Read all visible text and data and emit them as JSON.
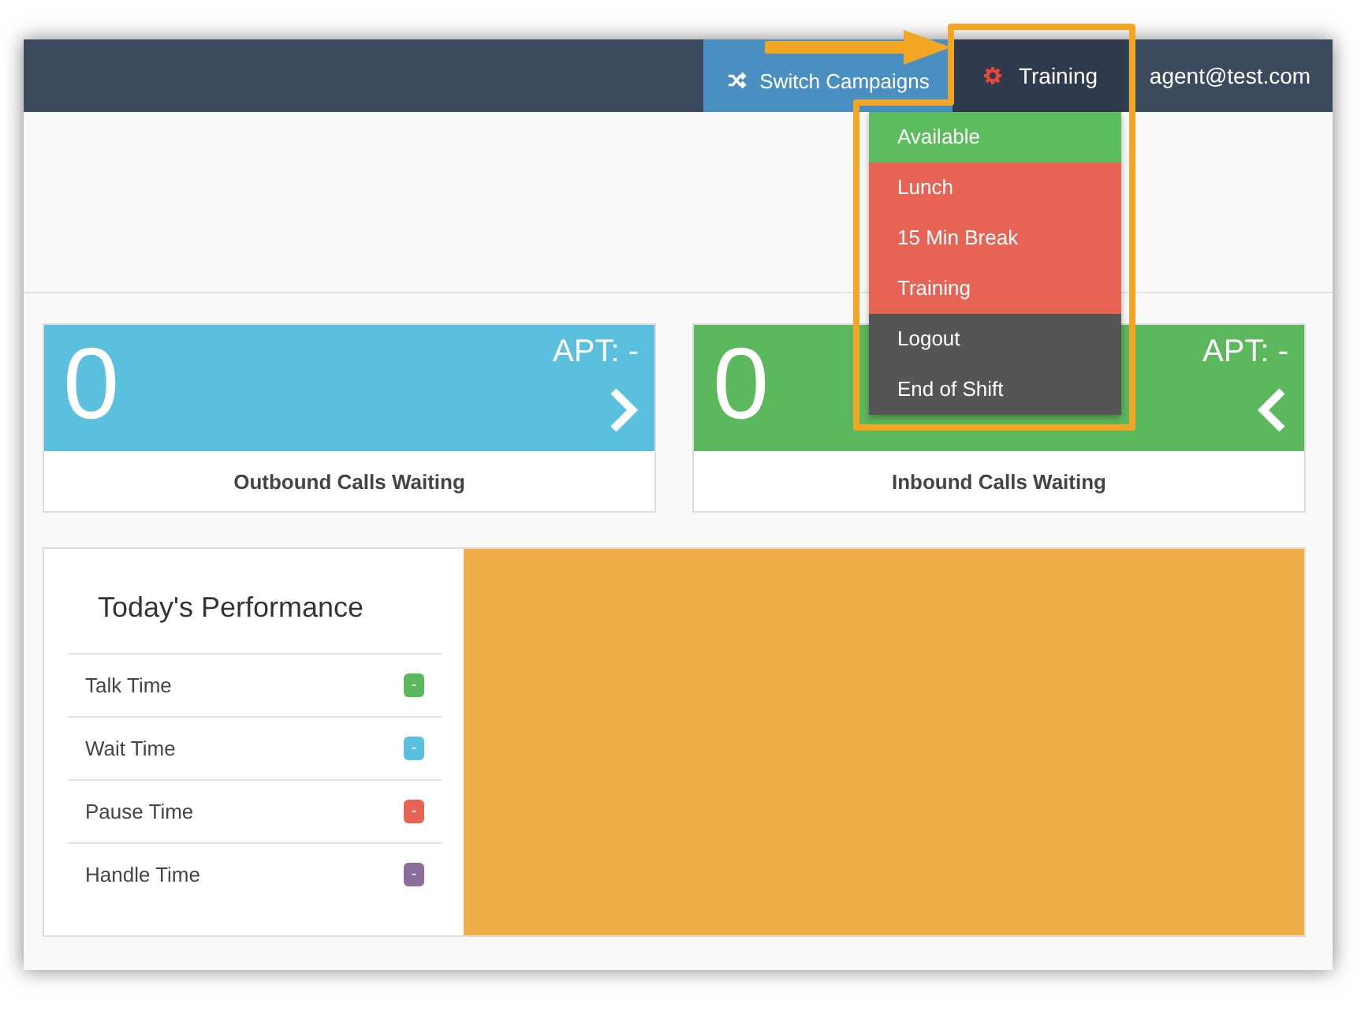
{
  "navbar": {
    "switch_button": "Switch Campaigns",
    "status_button": "Training",
    "user": "agent@test.com"
  },
  "status_menu": [
    {
      "label": "Available",
      "color": "#5cbd5e"
    },
    {
      "label": "Lunch",
      "color": "#e76455"
    },
    {
      "label": "15 Min Break",
      "color": "#e76455"
    },
    {
      "label": "Training",
      "color": "#e76455"
    },
    {
      "label": "Logout",
      "color": "#555555"
    },
    {
      "label": "End of Shift",
      "color": "#555555"
    }
  ],
  "cards": [
    {
      "count": "0",
      "apt": "APT: -",
      "label": "Outbound Calls Waiting",
      "color": "#5bc0de",
      "kind": "forward"
    },
    {
      "count": "0",
      "apt": "APT: -",
      "label": "Inbound Calls Waiting",
      "color": "#5cb85c",
      "kind": "back"
    }
  ],
  "performance": {
    "title": "Today's Performance",
    "rows": [
      {
        "label": "Talk Time",
        "value": "-",
        "color": "#5cb85c"
      },
      {
        "label": "Wait Time",
        "value": "-",
        "color": "#5bc0de"
      },
      {
        "label": "Pause Time",
        "value": "-",
        "color": "#e76455"
      },
      {
        "label": "Handle Time",
        "value": "-",
        "color": "#8a6d9a"
      }
    ]
  }
}
